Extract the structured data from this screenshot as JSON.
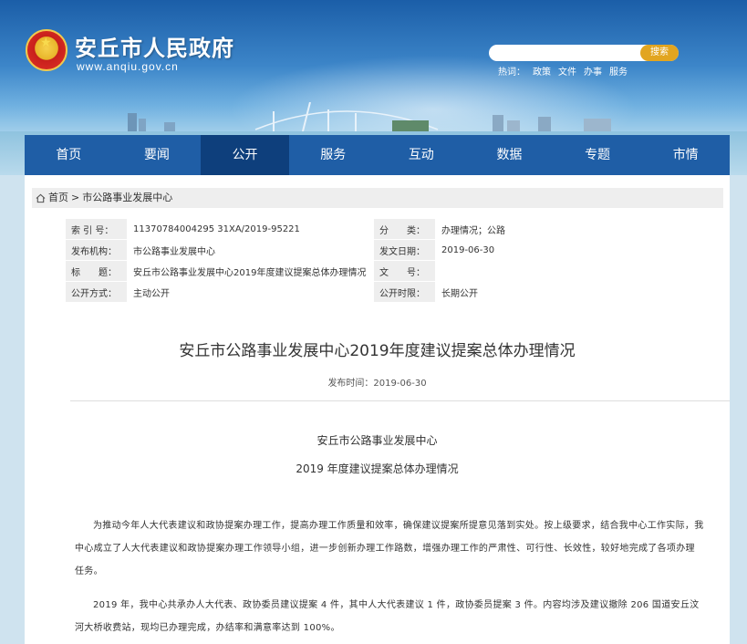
{
  "header": {
    "site_title": "安丘市人民政府",
    "site_url": "www.anqiu.gov.cn",
    "search_placeholder": "",
    "search_button": "搜索",
    "hot_label": "热词：",
    "hot_words": [
      "政策",
      "文件",
      "办事",
      "服务"
    ]
  },
  "nav": {
    "items": [
      "首页",
      "要闻",
      "公开",
      "服务",
      "互动",
      "数据",
      "专题",
      "市情"
    ],
    "active_index": 2
  },
  "breadcrumb": {
    "home": "首页",
    "separator": ">",
    "current": "市公路事业发展中心"
  },
  "meta": {
    "index_label": "索 引 号：",
    "index_value": "11370784004295 31XA/2019-95221",
    "category_label": "分　　类：",
    "category_value": "办理情况；公路",
    "publisher_label": "发布机构：",
    "publisher_value": "市公路事业发展中心",
    "date_label": "发文日期：",
    "date_value": "2019-06-30",
    "title_label": "标　　题：",
    "title_value": "安丘市公路事业发展中心2019年度建议提案总体办理情况",
    "docno_label": "文　　号：",
    "docno_value": "",
    "mode_label": "公开方式：",
    "mode_value": "主动公开",
    "period_label": "公开时限：",
    "period_value": "长期公开"
  },
  "article": {
    "title": "安丘市公路事业发展中心2019年度建议提案总体办理情况",
    "pub_time": "发布时间：2019-06-30",
    "sub_title_1": "安丘市公路事业发展中心",
    "sub_title_2": "2019 年度建议提案总体办理情况",
    "para_1": "为推动今年人大代表建议和政协提案办理工作，提高办理工作质量和效率，确保建议提案所提意见落到实处。按上级要求，结合我中心工作实际，我中心成立了人大代表建议和政协提案办理工作领导小组，进一步创新办理工作路数，增强办理工作的严肃性、可行性、长效性，较好地完成了各项办理任务。",
    "para_2": "2019 年，我中心共承办人大代表、政协委员建议提案 4 件，其中人大代表建议 1 件，政协委员提案 3 件。内容均涉及建议撤除 206 国道安丘汶河大桥收费站，现均已办理完成，办结率和满意率达到 100%。"
  },
  "colors": {
    "nav_bg": "#1f5ea6",
    "nav_active": "#0e3f7c",
    "search_button": "#e2a520"
  }
}
